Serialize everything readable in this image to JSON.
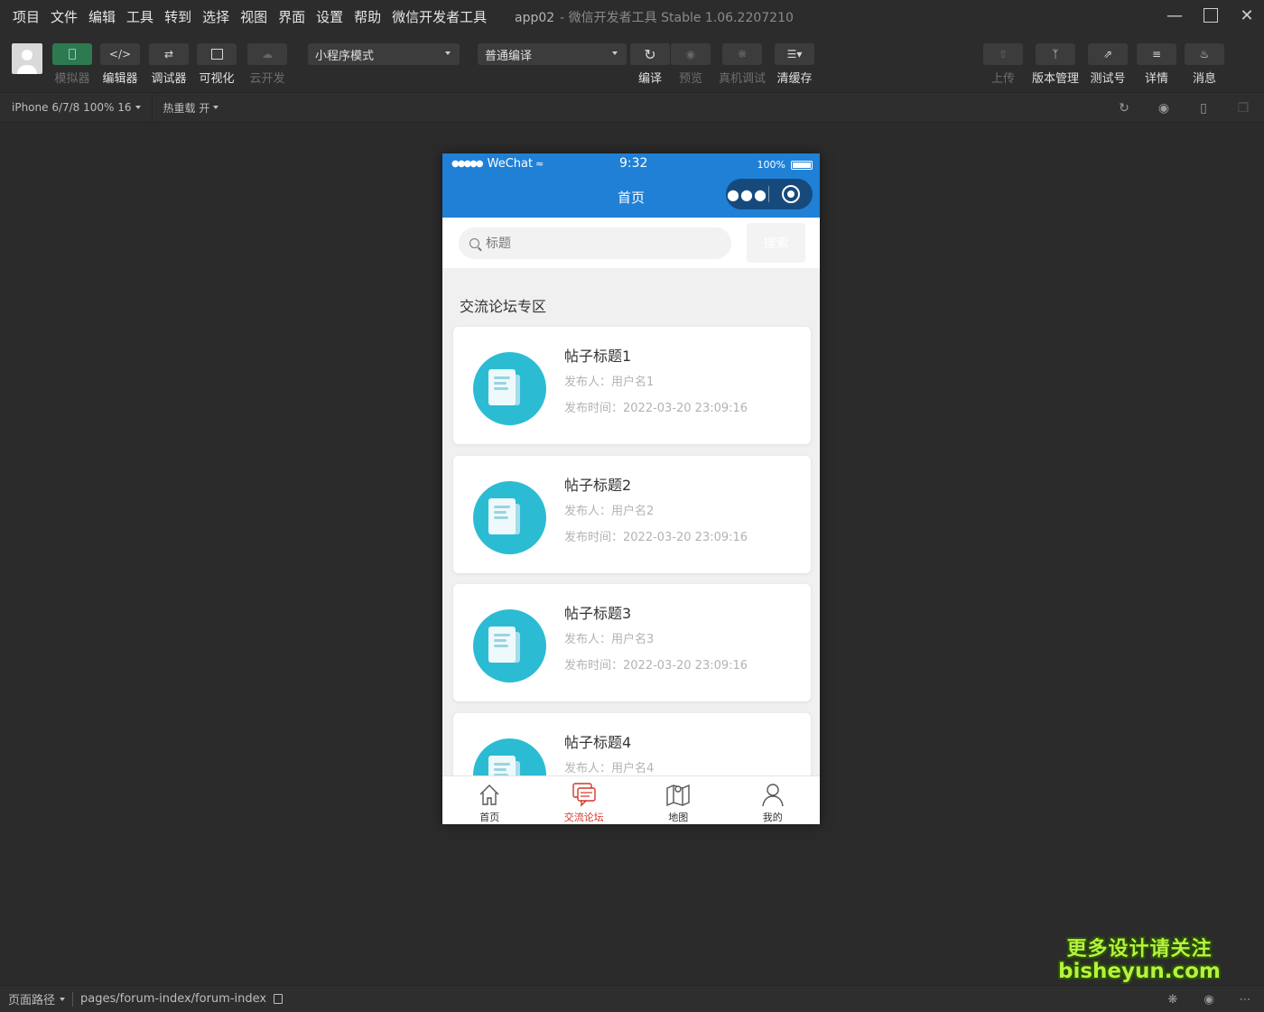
{
  "menu": [
    "项目",
    "文件",
    "编辑",
    "工具",
    "转到",
    "选择",
    "视图",
    "界面",
    "设置",
    "帮助",
    "微信开发者工具"
  ],
  "window": {
    "app": "app02",
    "title": "- 微信开发者工具 Stable 1.06.2207210"
  },
  "toolbar": {
    "simulator": "模拟器",
    "editor": "编辑器",
    "debugger": "调试器",
    "visual": "可视化",
    "cloud": "云开发",
    "mode_select": "小程序模式",
    "compile_select": "普通编译",
    "compile": "编译",
    "preview": "预览",
    "real_debug": "真机调试",
    "clear_cache": "清缓存",
    "upload": "上传",
    "version": "版本管理",
    "test_account": "测试号",
    "details": "详情",
    "messages": "消息"
  },
  "subbar": {
    "device": "iPhone 6/7/8 100% 16",
    "hot_reload": "热重载 开"
  },
  "phone": {
    "carrier": "WeChat",
    "time": "9:32",
    "battery": "100%",
    "nav_title": "首页",
    "search_placeholder": "标题",
    "search_button": "搜索",
    "section_title": "交流论坛专区",
    "posts": [
      {
        "title": "帖子标题1",
        "author": "发布人：用户名1",
        "time": "发布时间：2022-03-20 23:09:16"
      },
      {
        "title": "帖子标题2",
        "author": "发布人：用户名2",
        "time": "发布时间：2022-03-20 23:09:16"
      },
      {
        "title": "帖子标题3",
        "author": "发布人：用户名3",
        "time": "发布时间：2022-03-20 23:09:16"
      },
      {
        "title": "帖子标题4",
        "author": "发布人：用户名4",
        "time": ""
      }
    ],
    "tabs": [
      {
        "label": "首页",
        "icon": "home-icon"
      },
      {
        "label": "交流论坛",
        "icon": "forum-icon"
      },
      {
        "label": "地图",
        "icon": "map-icon"
      },
      {
        "label": "我的",
        "icon": "user-icon"
      }
    ],
    "active_tab_color": "#d2352b",
    "nav_color": "#1f80d6"
  },
  "bottombar": {
    "path_label": "页面路径",
    "path": "pages/forum-index/forum-index"
  },
  "watermark": {
    "line1": "更多设计请关注",
    "line2": "bisheyun.com"
  }
}
